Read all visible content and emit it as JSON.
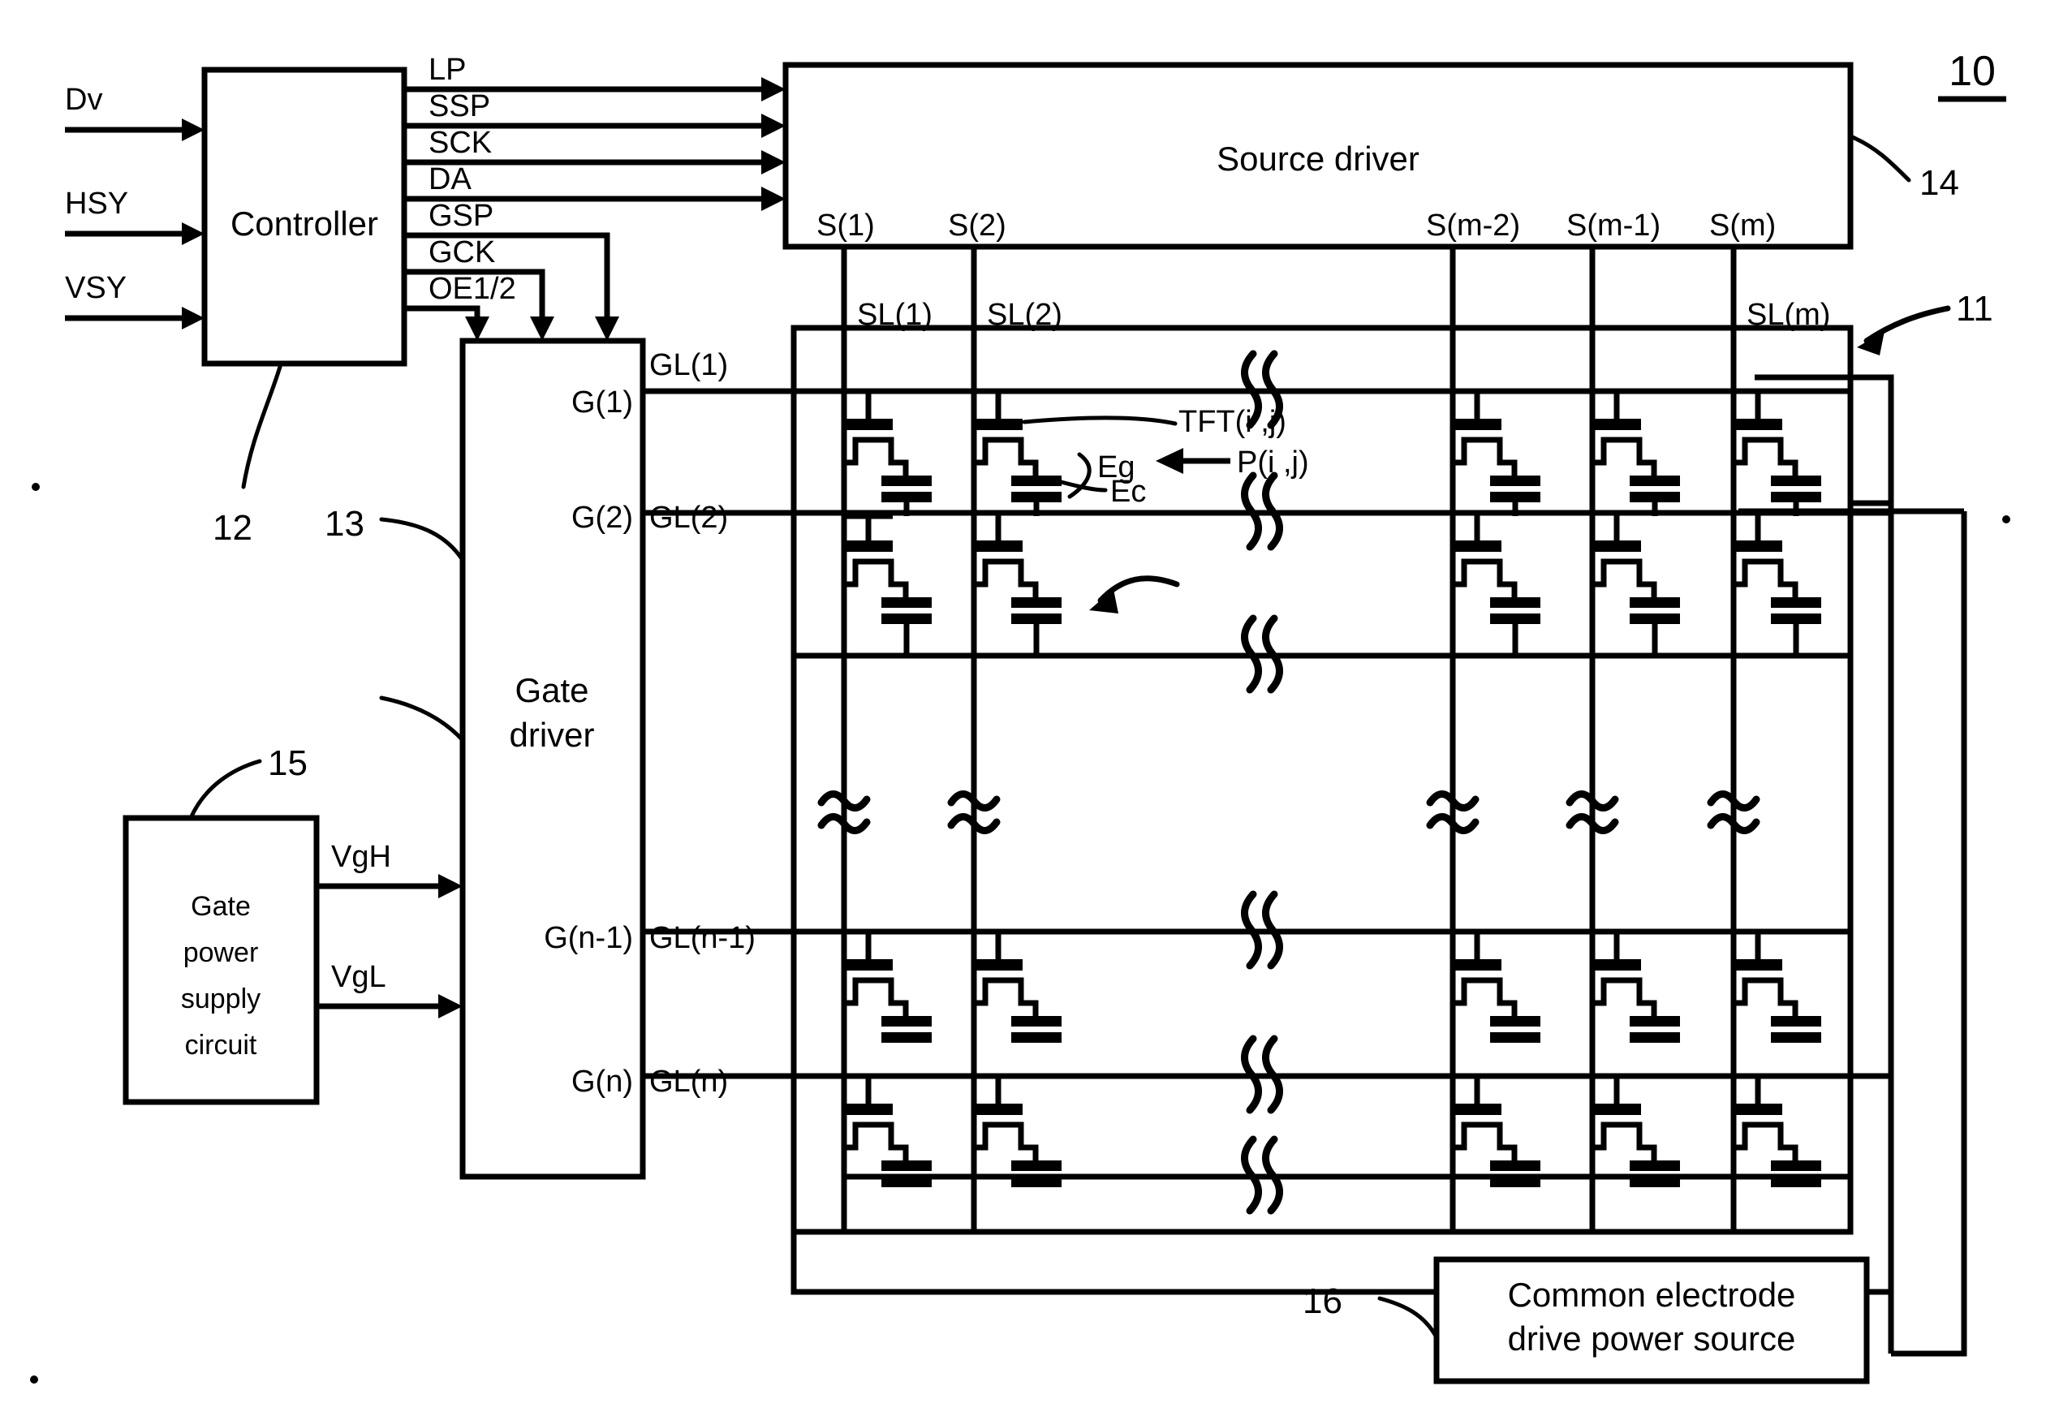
{
  "figure": {
    "reference_numerals": {
      "device": "10",
      "panel": "11",
      "controller": "12",
      "gate_driver": "13",
      "source_driver": "14",
      "gate_power_supply": "15",
      "common_electrode_source": "16"
    },
    "blocks": {
      "controller": "Controller",
      "source_driver": "Source driver",
      "gate_driver_line1": "Gate",
      "gate_driver_line2": "driver",
      "gate_power_line1": "Gate",
      "gate_power_line2": "power",
      "gate_power_line3": "supply",
      "gate_power_line4": "circuit",
      "common_line1": "Common electrode",
      "common_line2": "drive power source"
    },
    "controller_inputs": [
      "Dv",
      "HSY",
      "VSY"
    ],
    "controller_outputs_to_source": [
      "LP",
      "SSP",
      "SCK",
      "DA"
    ],
    "controller_outputs_to_gate": [
      "GSP",
      "GCK",
      "OE1/2"
    ],
    "power_signals": [
      "VgH",
      "VgL"
    ],
    "source_terminals": [
      "S(1)",
      "S(2)",
      "S(m-2)",
      "S(m-1)",
      "S(m)"
    ],
    "source_lines": [
      "SL(1)",
      "SL(2)",
      "SL(m)"
    ],
    "gate_terminals": [
      "G(1)",
      "G(2)",
      "G(n-1)",
      "G(n)"
    ],
    "gate_lines": [
      "GL(1)",
      "GL(2)",
      "GL(n-1)",
      "GL(n)"
    ],
    "pixel_annotations": {
      "tft": "TFT(i ,j)",
      "pixel": "P(i ,j)",
      "gate_electrode": "Eg",
      "cap_electrode": "Ec"
    }
  }
}
